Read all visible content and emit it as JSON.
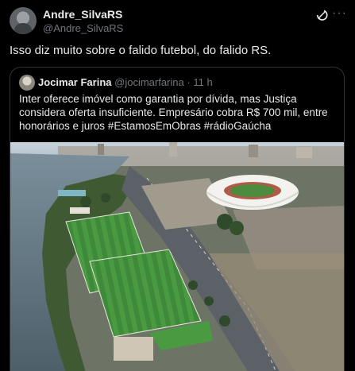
{
  "author": {
    "name": "Andre_SilvaRS",
    "handle": "@Andre_SilvaRS",
    "avatar_icon": "user-avatar"
  },
  "post": {
    "text": "Isso diz muito sobre o falido futebol, do falido RS."
  },
  "quoted": {
    "name": "Jocimar Farina",
    "handle": "@jocimarfarina",
    "separator": "·",
    "time": "11 h",
    "text": "Inter oferece imóvel como garantia por dívida, mas Justiça considera oferta insuficiente. Empresário cobra R$ 700 mil, entre honorários e juros #EstamosEmObras #rádioGaúcha",
    "image_description_icon": "aerial-stadium-photo"
  },
  "icons": {
    "grok": "grok-icon",
    "more": "more-icon"
  },
  "colors": {
    "background": "#000000",
    "text": "#e7e9ea",
    "muted": "#71767b",
    "border": "#2f3336"
  }
}
